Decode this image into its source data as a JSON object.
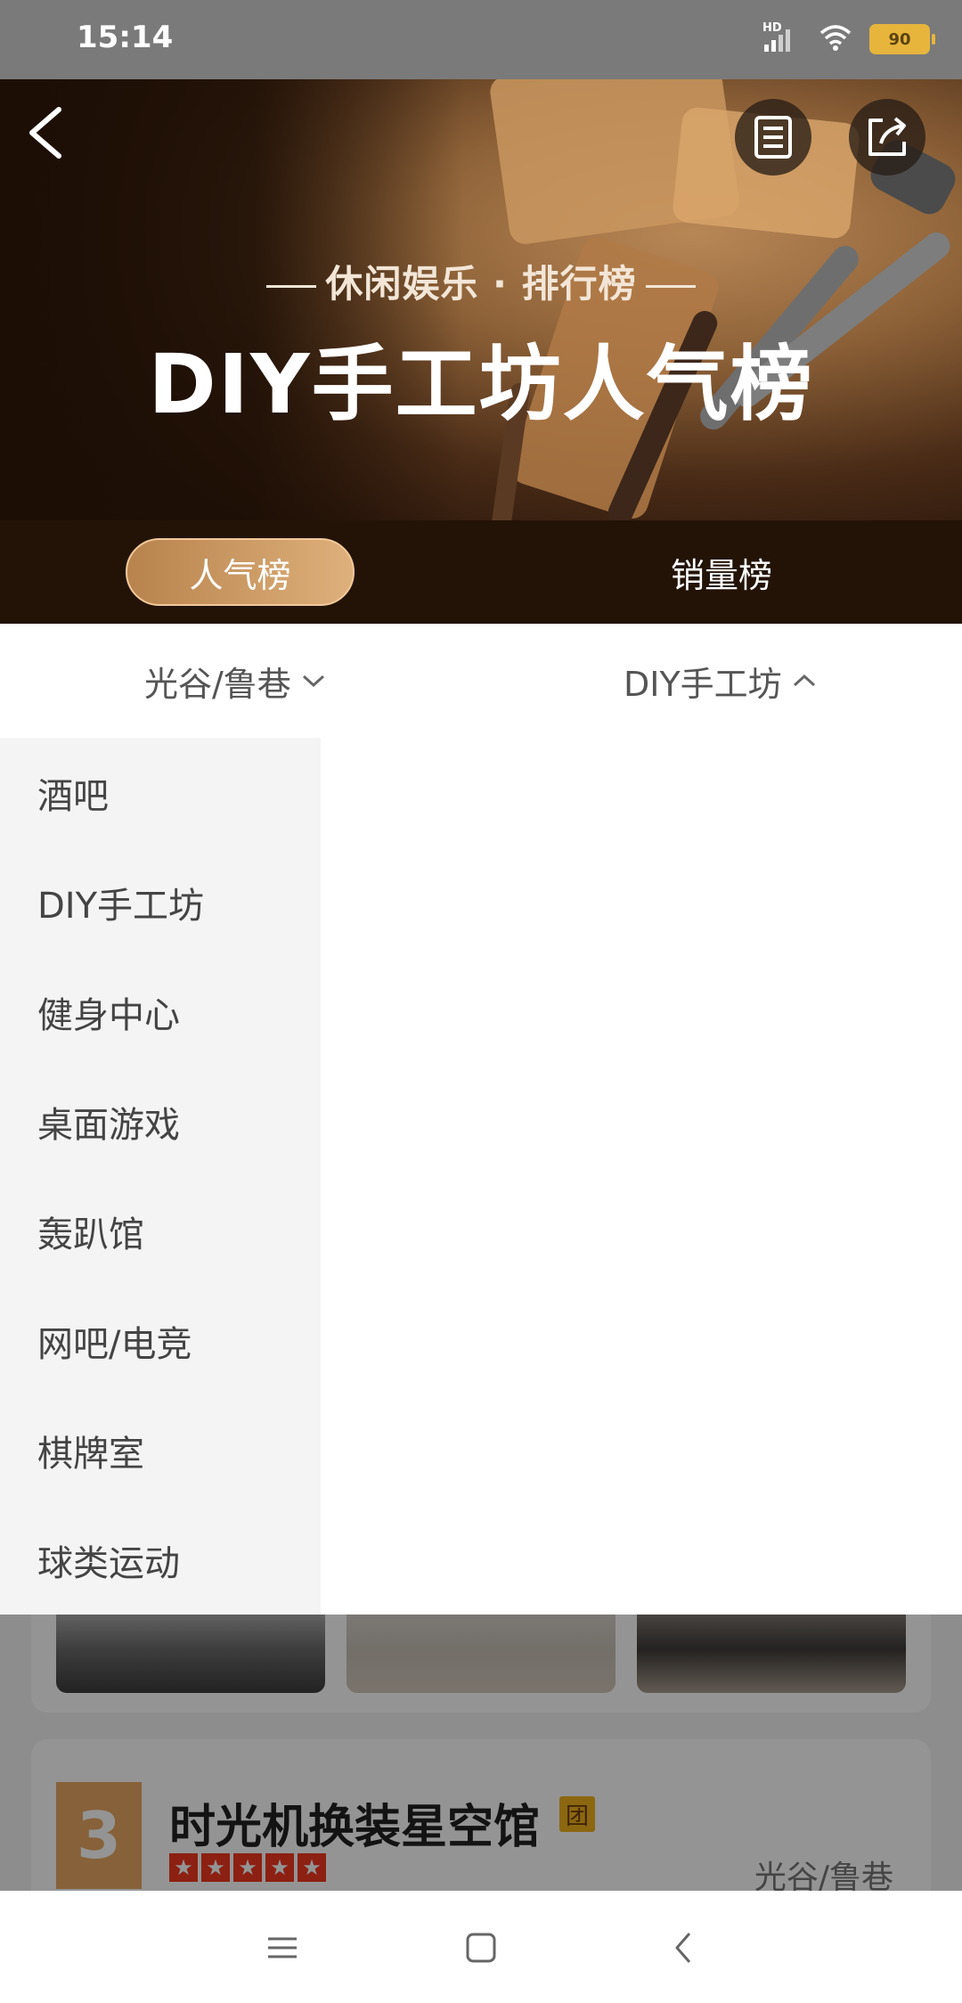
{
  "status_bar": {
    "time": "15:14",
    "network_label": "HD",
    "battery_level": "90",
    "icons": [
      "signal-icon",
      "wifi-icon",
      "battery-icon"
    ]
  },
  "hero": {
    "subtitle": "休闲娱乐 · 排行榜",
    "title": "DIY手工坊人气榜",
    "icons": [
      "back-arrow-icon",
      "list-icon",
      "share-icon"
    ]
  },
  "tabs": [
    {
      "label": "人气榜",
      "active": true
    },
    {
      "label": "销量榜",
      "active": false
    }
  ],
  "filters": {
    "region": {
      "label": "光谷/鲁巷",
      "icon": "chevron-down-icon"
    },
    "category": {
      "label": "DIY手工坊",
      "icon": "chevron-up-icon"
    }
  },
  "category_menu": {
    "items": [
      {
        "label": "酒吧"
      },
      {
        "label": "DIY手工坊"
      },
      {
        "label": "健身中心"
      },
      {
        "label": "桌面游戏"
      },
      {
        "label": "轰趴馆"
      },
      {
        "label": "网吧/电竞"
      },
      {
        "label": "棋牌室"
      },
      {
        "label": "球类运动"
      }
    ]
  },
  "list": {
    "item_3": {
      "rank": "3",
      "name": "时光机换装星空馆",
      "badge": "团",
      "region": "光谷/鲁巷",
      "rating_stars": 5
    }
  },
  "colors": {
    "tab_active_start": "#b8834d",
    "tab_active_end": "#deb07b",
    "tab_bar_bg": "#231307",
    "star_red": "#f2371f",
    "rank_gold": "#e8a862",
    "badge_yellow": "#f2b11e"
  },
  "nav_bar": {
    "icons": [
      "menu-icon",
      "home-icon",
      "back-icon"
    ]
  }
}
